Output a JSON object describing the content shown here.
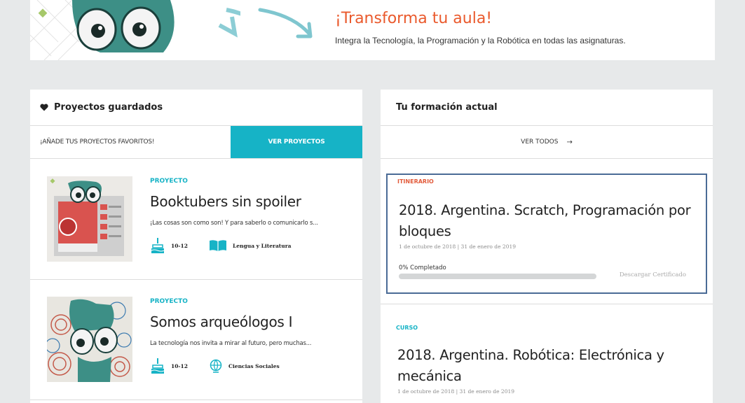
{
  "banner": {
    "title": "¡Transforma tu aula!",
    "subtitle": "Integra la Tecnología, la Programación y la Robótica en todas las asignaturas."
  },
  "saved_projects": {
    "header": "Proyectos guardados",
    "add_favorites": "¡AÑADE TUS PROYECTOS FAVORITOS!",
    "view_projects_button": "VER PROYECTOS",
    "items": [
      {
        "type": "PROYECTO",
        "title": "Booktubers sin spoiler",
        "description": "¡Las cosas son como son! Y para saberlo o comunicarlo s...",
        "age": "10-12",
        "subject": "Lengua y Literatura"
      },
      {
        "type": "PROYECTO",
        "title": "Somos arqueólogos I",
        "description": "La tecnología nos invita a mirar al futuro, pero muchas...",
        "age": "10-12",
        "subject": "Ciencias Sociales"
      }
    ]
  },
  "training": {
    "header": "Tu formación actual",
    "view_all": "VER TODOS",
    "arrow": "→",
    "itinerary": {
      "label": "ITINERARIO",
      "title": "2018. Argentina. Scratch, Programación por bloques",
      "dates": "1 de octubre de 2018 | 31 de enero de 2019",
      "progress_label": "0% Completado",
      "progress": 0,
      "download": "Descargar Certificado"
    },
    "course": {
      "label": "CURSO",
      "title": "2018. Argentina. Robótica: Electrónica y mecánica",
      "dates": "1 de octubre de 2018 | 31 de enero de 2019"
    }
  },
  "colors": {
    "accent": "#16b3c6",
    "banner_title": "#ea5a2d",
    "itinerary_label": "#e25b3b",
    "selection_border": "#4a6b96"
  }
}
